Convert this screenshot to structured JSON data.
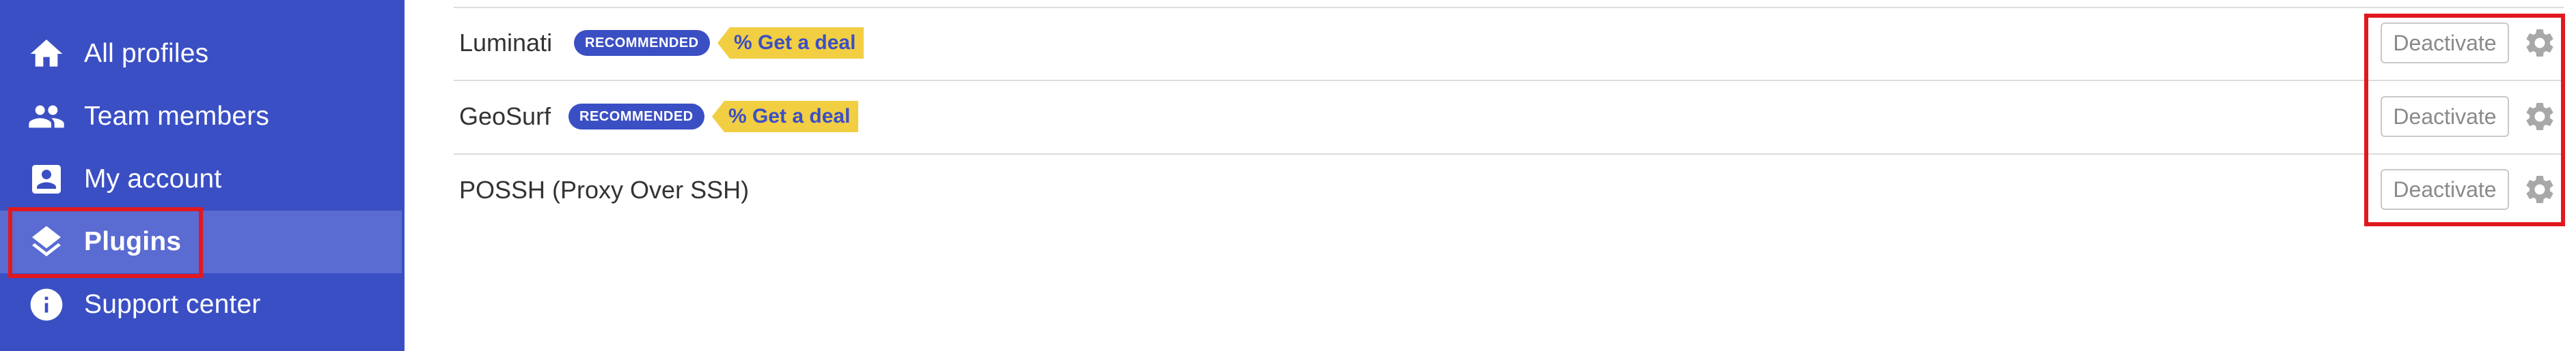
{
  "sidebar": {
    "items": [
      {
        "label": "All profiles",
        "icon": "home-icon"
      },
      {
        "label": "Team members",
        "icon": "people-icon"
      },
      {
        "label": "My account",
        "icon": "account-box-icon"
      },
      {
        "label": "Plugins",
        "icon": "layers-icon",
        "active": true
      },
      {
        "label": "Support center",
        "icon": "info-icon"
      }
    ]
  },
  "plugins": {
    "rows": [
      {
        "name": "Luminati",
        "badge": "RECOMMENDED",
        "deal": "% Get a deal",
        "action": "Deactivate"
      },
      {
        "name": "GeoSurf",
        "badge": "RECOMMENDED",
        "deal": "% Get a deal",
        "action": "Deactivate"
      },
      {
        "name": "POSSH (Proxy Over SSH)",
        "action": "Deactivate"
      }
    ]
  },
  "colors": {
    "sidebar_bg": "#3b4fc4",
    "sidebar_active": "#5a6bd2",
    "badge_bg": "#3b4fc4",
    "deal_bg": "#f2ce43",
    "highlight": "#e0191f"
  }
}
